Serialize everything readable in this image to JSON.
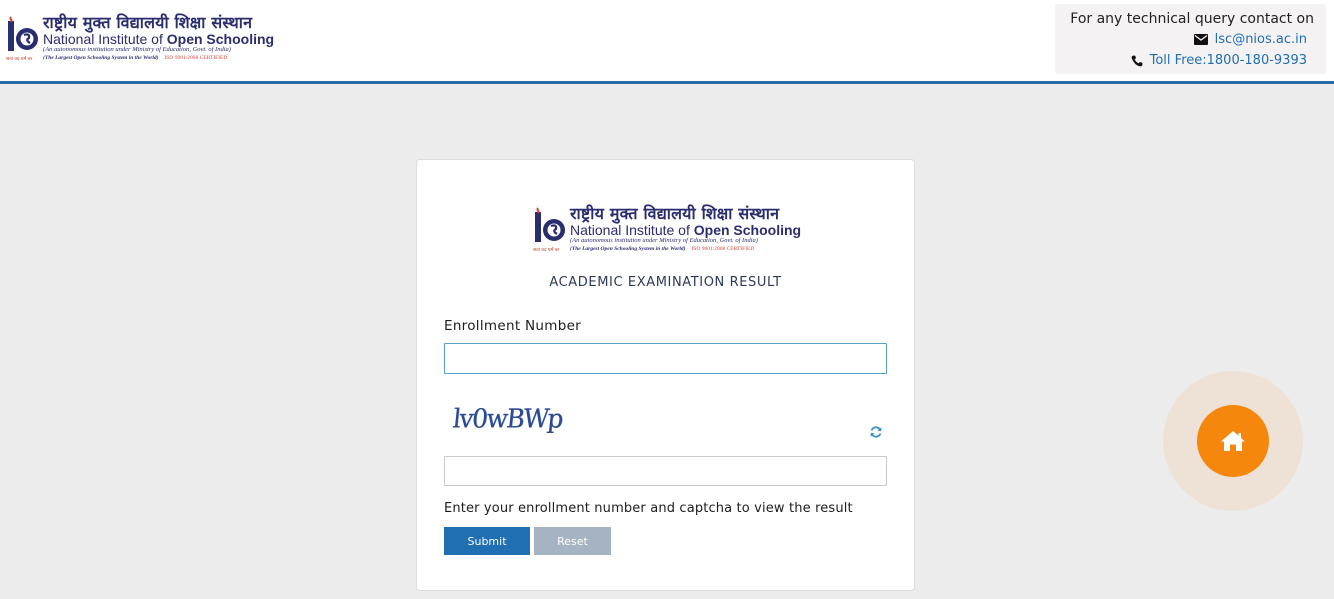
{
  "org": {
    "hindi_name": "राष्ट्रीय मुक्त विद्यालयी शिक्षा संस्थान",
    "english_prefix": "National Institute of ",
    "english_bold": "Open Schooling",
    "subtitle": "(An autonomous institution under Ministry of Education, Govt. of India)",
    "tagline": "(The Largest Open Schooling System in the World)",
    "certification": "ISO 9001:2008 CERTIFIED",
    "motto": "सत्यं वद धर्मं चर"
  },
  "contact": {
    "heading": "For any technical query contact on",
    "email": "lsc@nios.ac.in",
    "phone": "Toll Free:1800-180-9393"
  },
  "form": {
    "title": "ACADEMIC EXAMINATION RESULT",
    "enrollment_label": "Enrollment Number",
    "enrollment_value": "",
    "captcha_text": "lv0wBWp",
    "captcha_value": "",
    "hint": "Enter your enrollment number and captcha to view the result",
    "submit_label": "Submit",
    "reset_label": "Reset"
  },
  "colors": {
    "brand_navy": "#2a2d6e",
    "primary_blue": "#1f6fb2",
    "reset_gray": "#a6b3c2",
    "home_orange": "#f4870c",
    "background": "#ececec"
  },
  "icons": [
    "nios-logo-icon",
    "envelope-icon",
    "phone-icon",
    "refresh-icon",
    "home-icon"
  ]
}
